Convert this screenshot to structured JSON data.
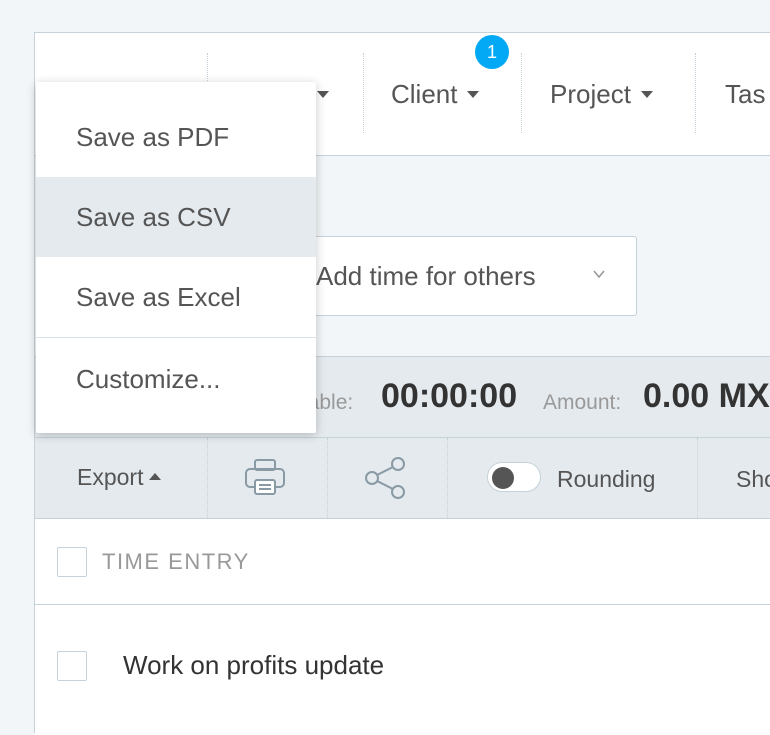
{
  "filters": {
    "client": "Client",
    "project": "Project",
    "task": "Tas",
    "badge_count": "1"
  },
  "add_time": {
    "label": "Add time for others"
  },
  "totals": {
    "billable_label": "lable:",
    "billable_value": "00:00:00",
    "amount_label": "Amount:",
    "amount_value": "0.00 MX"
  },
  "toolbar": {
    "export_label": "Export",
    "rounding_label": "Rounding",
    "rounding_on": false,
    "show_label": "Sho"
  },
  "export_menu": {
    "items": [
      "Save as PDF",
      "Save as CSV",
      "Save as Excel",
      "Customize..."
    ],
    "highlighted": "Save as CSV"
  },
  "table": {
    "header": "TIME ENTRY",
    "rows": [
      {
        "description": "Work on profits update"
      }
    ]
  },
  "colors": {
    "accent": "#03a9f4",
    "background": "#f2f6f8",
    "bar": "#e4eaee",
    "border": "#c6d2d9"
  }
}
